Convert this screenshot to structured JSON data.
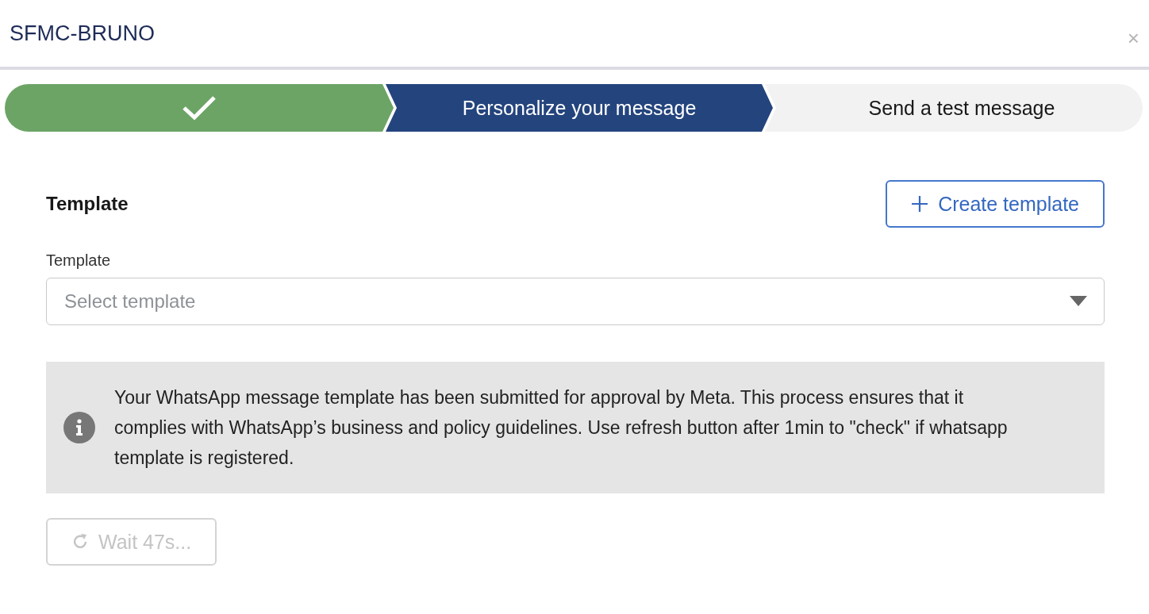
{
  "window": {
    "title": "SFMC-BRUNO",
    "close": "×"
  },
  "steps": [
    {
      "completed": true,
      "selected": false
    },
    {
      "completed": false,
      "selected": true,
      "label": "Personalize your message"
    },
    {
      "completed": false,
      "selected": false,
      "label": "Send a test message"
    }
  ],
  "section": {
    "heading": "Template",
    "create_button": "Create template"
  },
  "template_field": {
    "label": "Template",
    "placeholder": "Select template"
  },
  "info": {
    "text": "Your WhatsApp message template has been submitted for approval by Meta. This process ensures that it complies with WhatsApp’s business and policy guidelines. Use refresh button after 1min to \"check\" if whatsapp template is registered."
  },
  "refresh_button": {
    "label": "Wait 47s...",
    "disabled": true
  }
}
